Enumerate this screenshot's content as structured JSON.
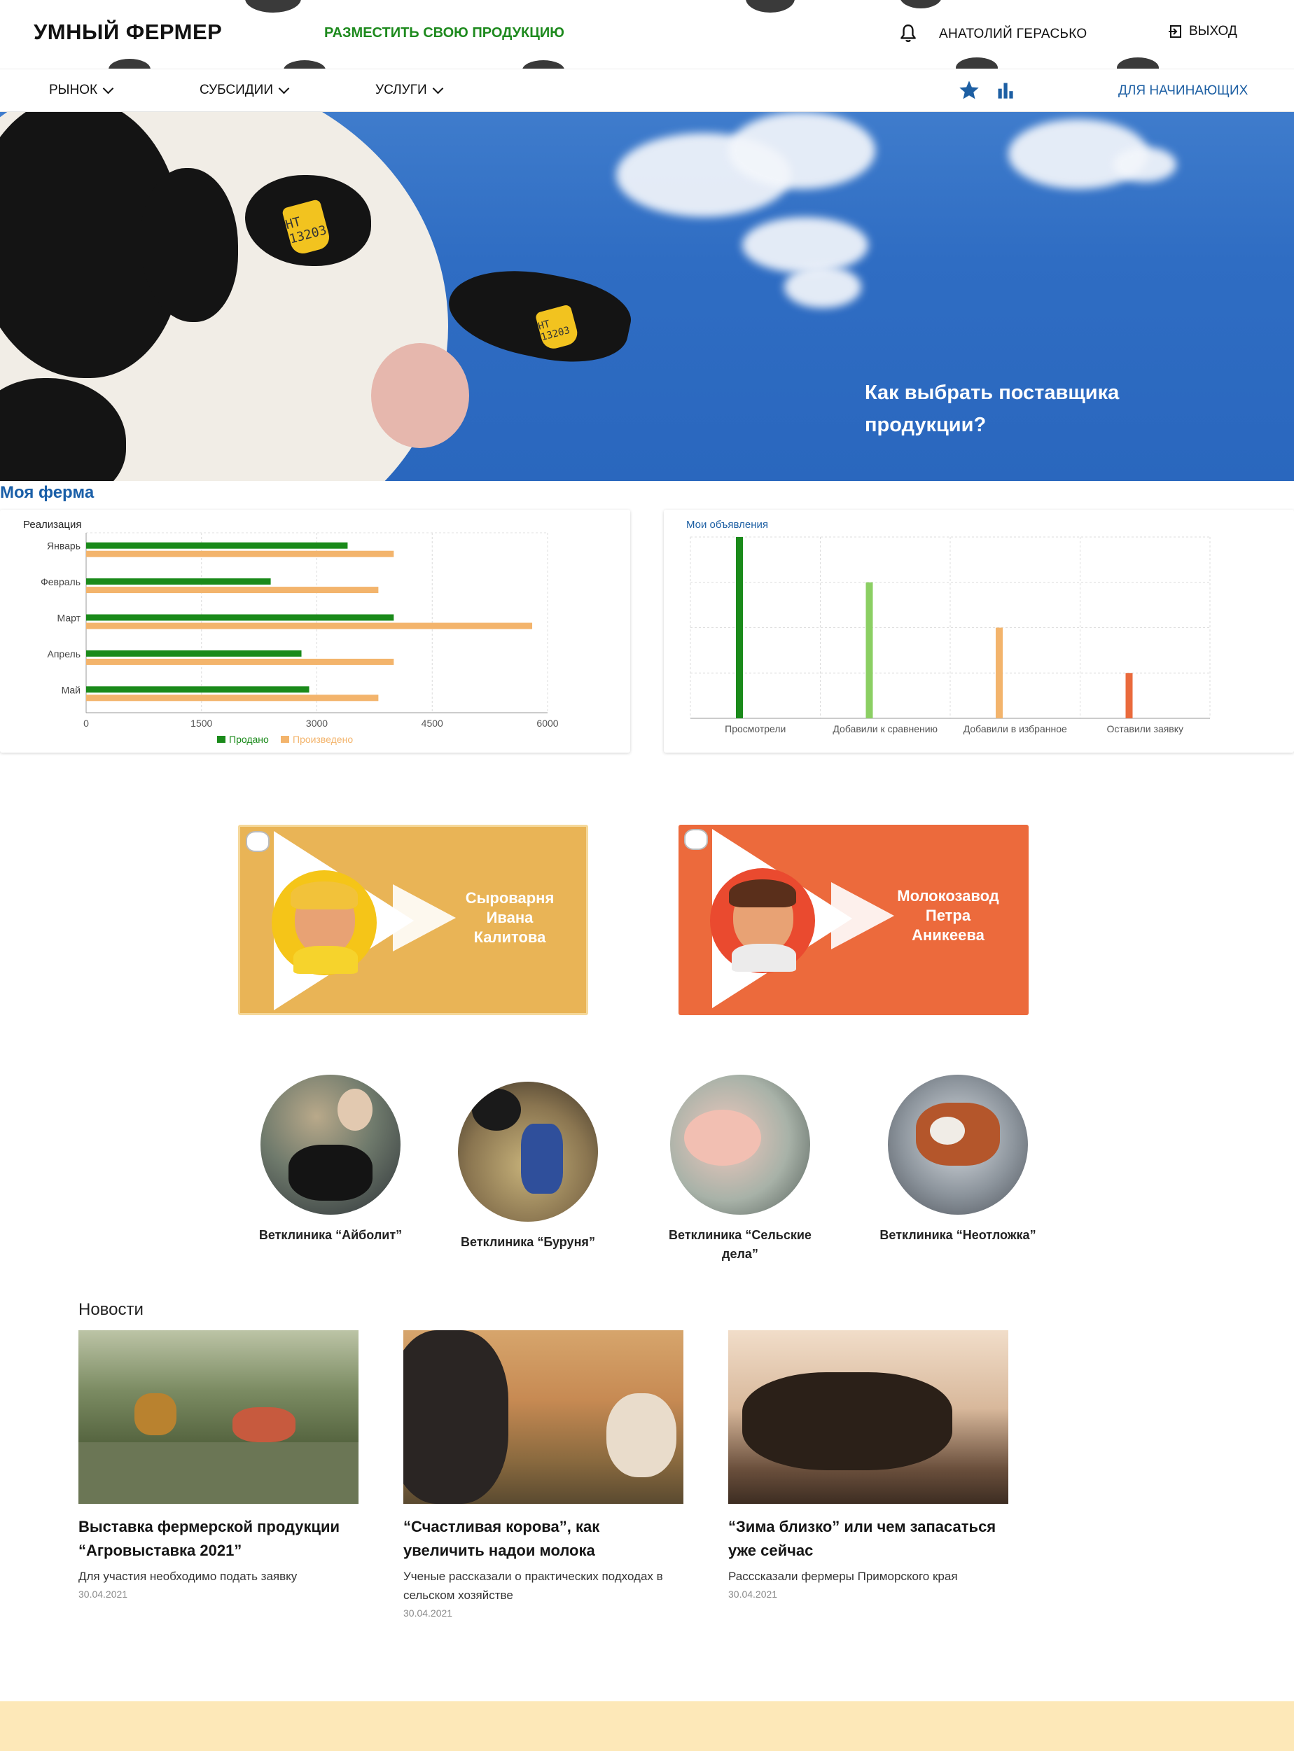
{
  "header": {
    "brand": "УМНЫЙ ФЕРМЕР",
    "post_product": "РАЗМЕСТИТЬ СВОЮ ПРОДУКЦИЮ",
    "user_name": "АНАТОЛИЙ ГЕРАСЬКО",
    "logout": "ВЫХОД",
    "accent_color": "#1e8a1e"
  },
  "nav": {
    "items": [
      {
        "label": "РЫНОК"
      },
      {
        "label": "СУБСИДИИ"
      },
      {
        "label": "УСЛУГИ"
      }
    ],
    "beginners": "ДЛЯ НАЧИНАЮЩИХ",
    "icons": [
      "star-icon",
      "bar-chart-icon"
    ],
    "icon_color": "#1d5fa3"
  },
  "hero": {
    "title": "Как выбрать поставщика продукции?",
    "ear_tag_1": "HT 13203",
    "ear_tag_2": "HT 13203"
  },
  "farm": {
    "title": "Моя ферма"
  },
  "chart_data": [
    {
      "type": "bar",
      "orientation": "horizontal",
      "title": "Реализация",
      "categories": [
        "Январь",
        "Февраль",
        "Март",
        "Апрель",
        "Май"
      ],
      "series": [
        {
          "name": "Продано",
          "color": "#1a8a1a",
          "values": [
            3400,
            2400,
            4000,
            2800,
            2900
          ]
        },
        {
          "name": "Произведено",
          "color": "#f3b46c",
          "values": [
            4000,
            3800,
            5800,
            4000,
            3800
          ]
        }
      ],
      "xlim": [
        0,
        6000
      ],
      "xticks": [
        0,
        1500,
        3000,
        4500,
        6000
      ],
      "grid": true,
      "legend": "bottom"
    },
    {
      "type": "bar",
      "title": "Мои объявления",
      "categories": [
        "Просмотрели",
        "Добавили к сравнению",
        "Добавили в избранное",
        "Оставили заявку"
      ],
      "values": [
        4,
        3,
        2,
        1
      ],
      "colors": [
        "#1a8a1a",
        "#8bcf63",
        "#f3b46c",
        "#ea6a3c"
      ],
      "ylim": [
        0,
        4
      ],
      "grid": true
    }
  ],
  "videos": [
    {
      "title": "Сыроварня Ивана Калитова",
      "color": "#e9b456"
    },
    {
      "title": "Молокозавод Петра Аникеева",
      "color": "#ec6a3c"
    }
  ],
  "clinics": [
    {
      "name": "Ветклиника “Айболит”"
    },
    {
      "name": "Ветклиника “Буруня”"
    },
    {
      "name": "Ветклиника “Сельские дела”"
    },
    {
      "name": "Ветклиника “Неотложка”"
    }
  ],
  "news": {
    "title": "Новости",
    "items": [
      {
        "headline": "Выставка фермерской продукции “Агровыставка 2021”",
        "subtitle": "Для участия необходимо подать заявку",
        "date": "30.04.2021"
      },
      {
        "headline": "“Счастливая корова”, как увеличить надои молока",
        "subtitle": "Ученые рассказали о практических подходах в сельском хозяйстве",
        "date": "30.04.2021"
      },
      {
        "headline": "“Зима близко” или чем запасаться уже сейчас",
        "subtitle": "Расссказали фермеры Приморского края",
        "date": "30.04.2021"
      }
    ]
  }
}
